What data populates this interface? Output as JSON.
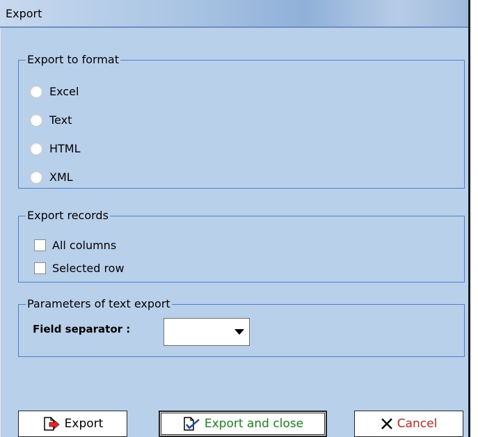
{
  "window": {
    "title": "Export"
  },
  "format_group": {
    "legend": "Export to format",
    "options": [
      {
        "label": "Excel",
        "selected": false
      },
      {
        "label": "Text",
        "selected": false
      },
      {
        "label": "HTML",
        "selected": false
      },
      {
        "label": "XML",
        "selected": false
      }
    ]
  },
  "records_group": {
    "legend": "Export records",
    "options": [
      {
        "label": "All columns",
        "checked": false
      },
      {
        "label": "Selected row",
        "checked": false
      }
    ]
  },
  "text_params_group": {
    "legend": "Parameters of text export",
    "field_separator_label": "Field separator :",
    "field_separator_value": ""
  },
  "buttons": {
    "export": {
      "label": "Export",
      "icon": "export-arrow-icon"
    },
    "export_close": {
      "label": "Export and close",
      "icon": "export-check-icon",
      "color": "#138a13"
    },
    "cancel": {
      "label": "Cancel",
      "icon": "close-x-icon",
      "color": "#d41f1f"
    }
  },
  "colors": {
    "background": "#b8d0ea",
    "group_border": "#4a7fc9"
  }
}
